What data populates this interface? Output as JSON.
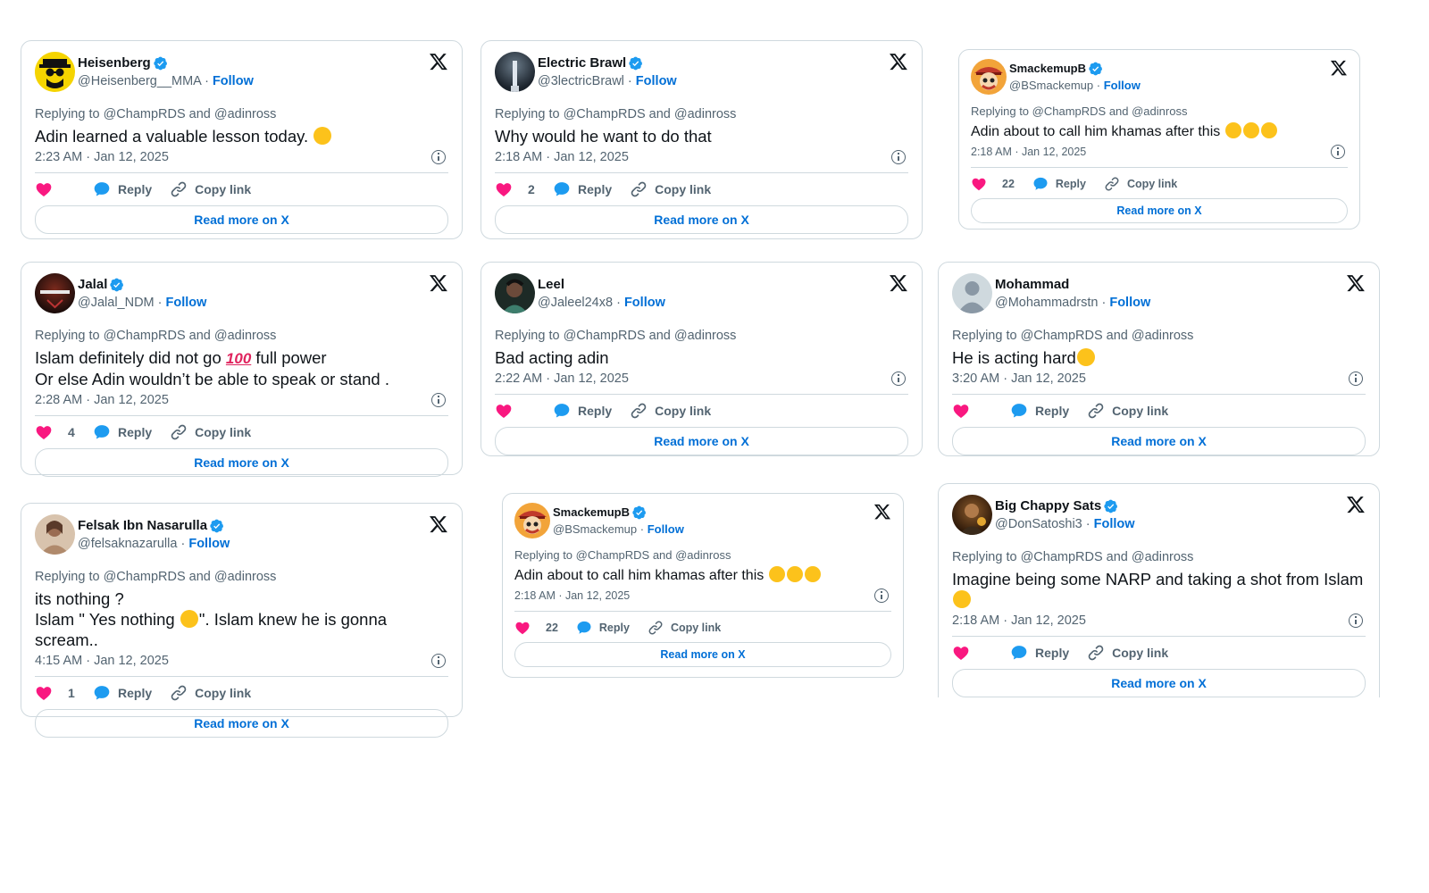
{
  "colors": {
    "accent": "#006fd6",
    "heart": "#f91880",
    "reply": "#1d9bf0",
    "muted": "#536471",
    "border": "#cfd9de",
    "verified": "#1d9bf0"
  },
  "common": {
    "reply_label": "Reply",
    "copy_label": "Copy link",
    "read_more_label": "Read more on X",
    "follow_label": "Follow",
    "replying_to": "Replying to @ChampRDS and @adinross"
  },
  "tweets": [
    {
      "name": "Heisenberg",
      "verified": true,
      "handle": "@Heisenberg__MMA",
      "text": "Adin learned a valuable lesson today.",
      "emoji": [
        "laughing-tears"
      ],
      "time": "2:23 AM · Jan 12, 2025",
      "likes": "",
      "avatar": "heisenberg-avatar"
    },
    {
      "name": "Electric Brawl",
      "verified": true,
      "handle": "@3lectricBrawl",
      "text": "Why would he want to do that",
      "emoji": [],
      "time": "2:18 AM · Jan 12, 2025",
      "likes": "2",
      "avatar": "electric-brawl-avatar"
    },
    {
      "name": "SmackemupB",
      "verified": true,
      "handle": "@BSmackemup",
      "text": "Adin about to call him khamas after this",
      "emoji": [
        "crying",
        "crying",
        "laughing-tears"
      ],
      "time": "2:18 AM · Jan 12, 2025",
      "likes": "22",
      "avatar": "smackemup-avatar"
    },
    {
      "name": "Jalal",
      "verified": true,
      "handle": "@Jalal_NDM",
      "text_line1": "Islam definitely did not go",
      "text_line1b": "full power",
      "text_line2": "Or else Adin wouldn’t be able to speak or stand .",
      "emoji": [
        "hundred"
      ],
      "time": "2:28 AM · Jan 12, 2025",
      "likes": "4",
      "avatar": "jalal-avatar"
    },
    {
      "name": "Leel",
      "verified": false,
      "handle": "@Jaleel24x8",
      "text": "Bad acting adin",
      "emoji": [],
      "time": "2:22 AM · Jan 12, 2025",
      "likes": "",
      "avatar": "leel-avatar"
    },
    {
      "name": "Mohammad",
      "verified": false,
      "handle": "@Mohammadrstn",
      "text": "He is acting hard",
      "emoji": [
        "laughing-tears"
      ],
      "time": "3:20 AM · Jan 12, 2025",
      "likes": "",
      "avatar": "default-avatar"
    },
    {
      "name": "Felsak Ibn Nasarulla",
      "verified": true,
      "handle": "@felsaknazarulla",
      "text_line1": "its nothing ?",
      "text_line2a": "Islam \" Yes nothing",
      "text_line2b": "\". Islam knew he is gonna scream..",
      "emoji": [
        "hand-over-mouth"
      ],
      "time": "4:15 AM · Jan 12, 2025",
      "likes": "1",
      "avatar": "felsak-avatar"
    },
    {
      "name": "SmackemupB",
      "verified": true,
      "handle": "@BSmackemup",
      "text": "Adin about to call him khamas after this",
      "emoji": [
        "crying",
        "crying",
        "laughing-tears"
      ],
      "time": "2:18 AM · Jan 12, 2025",
      "likes": "22",
      "avatar": "smackemup-avatar"
    },
    {
      "name": "Big Chappy Sats",
      "verified": true,
      "handle": "@DonSatoshi3",
      "text": "Imagine being some NARP and taking a shot from Islam",
      "emoji": [
        "crying"
      ],
      "time": "2:18 AM · Jan 12, 2025",
      "likes": "",
      "avatar": "big-chappy-avatar"
    }
  ]
}
